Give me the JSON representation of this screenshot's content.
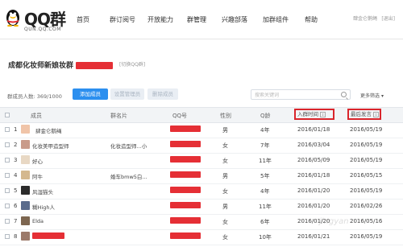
{
  "header": {
    "logo_title": "QQ群",
    "logo_url": "QUN.QQ.COM",
    "nav": [
      "首页",
      "群订阅号",
      "开放能力",
      "群管理",
      "兴趣部落",
      "加群组件",
      "帮助"
    ],
    "user_text": "肆金仑鹅绳",
    "logout": "[退出]"
  },
  "group": {
    "name": "成都化妆师新娘妆群",
    "switch_label": "[切换QQ群]"
  },
  "toolbar": {
    "member_count": "群成员人数: 369/1000",
    "add_member": "添加成员",
    "set_admin": "设置管理员",
    "delete_member": "删除成员",
    "search_placeholder": "搜索关键词",
    "more_filter": "更多筛选"
  },
  "table": {
    "headers": [
      "成员",
      "群名片",
      "QQ号",
      "性别",
      "Q龄",
      "入群时间",
      "最后发言"
    ],
    "rows": [
      {
        "num": "1",
        "member": "肆金仑鹅绳",
        "card": "",
        "gender": "男",
        "qage": "4年",
        "join": "2016/01/18",
        "last": "2016/05/19"
      },
      {
        "num": "2",
        "member": "化妆美甲造型师",
        "card": "化妆造型师...小",
        "gender": "女",
        "qage": "7年",
        "join": "2016/03/04",
        "last": "2016/05/19"
      },
      {
        "num": "3",
        "member": "好心",
        "card": "",
        "gender": "女",
        "qage": "11年",
        "join": "2016/05/09",
        "last": "2016/05/19"
      },
      {
        "num": "4",
        "member": "阿牛",
        "card": "婚车bmw5白...",
        "gender": "男",
        "qage": "5年",
        "join": "2016/01/18",
        "last": "2016/05/15"
      },
      {
        "num": "5",
        "member": "风湿猫头",
        "card": "",
        "gender": "女",
        "qage": "4年",
        "join": "2016/01/20",
        "last": "2016/05/19"
      },
      {
        "num": "6",
        "member": "糊High人",
        "card": "",
        "gender": "男",
        "qage": "11年",
        "join": "2016/01/20",
        "last": "2016/02/26"
      },
      {
        "num": "7",
        "member": "Elda",
        "card": "",
        "gender": "女",
        "qage": "6年",
        "join": "2016/01/20",
        "last": "2016/05/16"
      },
      {
        "num": "8",
        "member": "",
        "card": "",
        "gender": "女",
        "qage": "10年",
        "join": "2016/01/21",
        "last": "2016/05/19"
      }
    ]
  },
  "watermark": "jingyan"
}
